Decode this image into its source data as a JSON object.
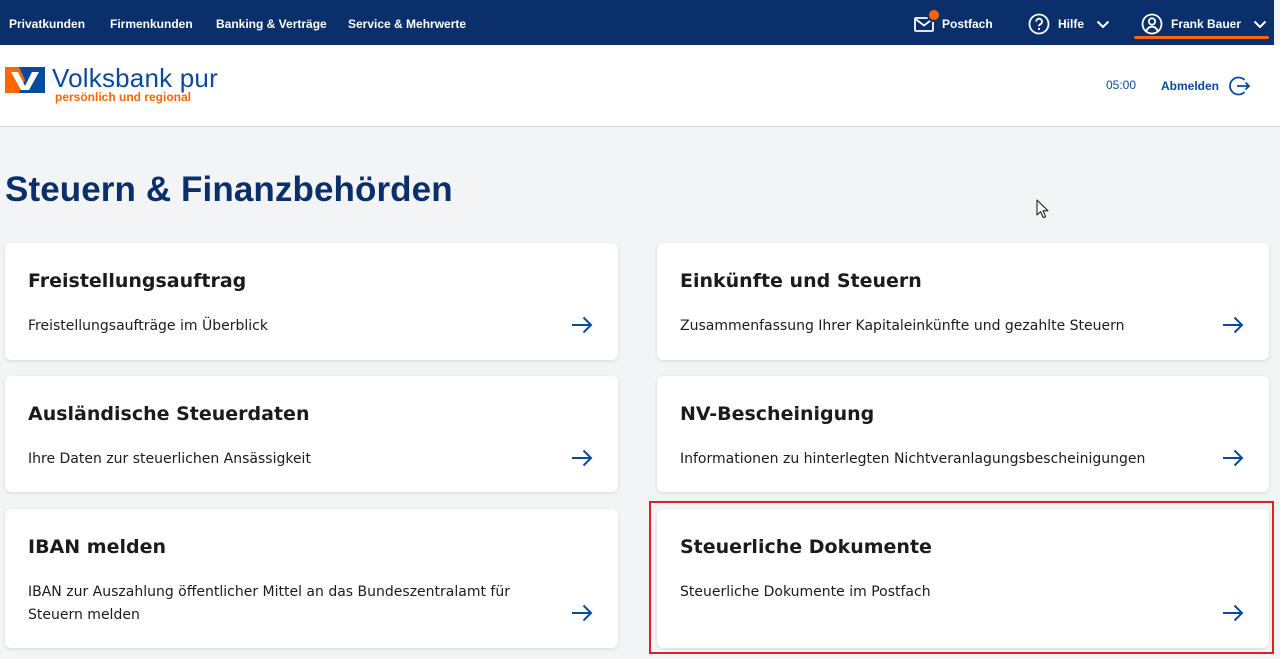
{
  "topnav": {
    "links": [
      "Privatkunden",
      "Firmenkunden",
      "Banking & Verträge",
      "Service & Mehrwerte"
    ],
    "postfach_label": "Postfach",
    "hilfe_label": "Hilfe",
    "user_name": "Frank Bauer"
  },
  "header": {
    "logo_name": "Volksbank pur",
    "logo_tagline": "persönlich und regional",
    "session_timer": "05:00",
    "logout_label": "Abmelden"
  },
  "page": {
    "title": "Steuern & Finanzbehörden"
  },
  "cards": [
    {
      "title": "Freistellungsauftrag",
      "description": "Freistellungsaufträge im Überblick"
    },
    {
      "title": "Einkünfte und Steuern",
      "description": "Zusammenfassung Ihrer Kapitaleinkünfte und gezahlte Steuern"
    },
    {
      "title": "Ausländische Steuerdaten",
      "description": "Ihre Daten zur steuerlichen Ansässigkeit"
    },
    {
      "title": "NV-Bescheinigung",
      "description": "Informationen zu hinterlegten Nichtveranlagungsbescheinigungen"
    },
    {
      "title": "IBAN melden",
      "description": "IBAN zur Auszahlung öffentlicher Mittel an das Bundeszentralamt für Steuern melden"
    },
    {
      "title": "Steuerliche Dokumente",
      "description": "Steuerliche Dokumente im Postfach"
    }
  ],
  "colors": {
    "brand_navy": "#0a2f6b",
    "brand_blue": "#0a4a9e",
    "brand_orange": "#ff6600",
    "highlight_red": "#d9202b"
  },
  "icons": [
    "mail-icon",
    "help-circle-icon",
    "chevron-down-icon",
    "user-circle-icon",
    "logout-icon",
    "arrow-right-icon"
  ]
}
